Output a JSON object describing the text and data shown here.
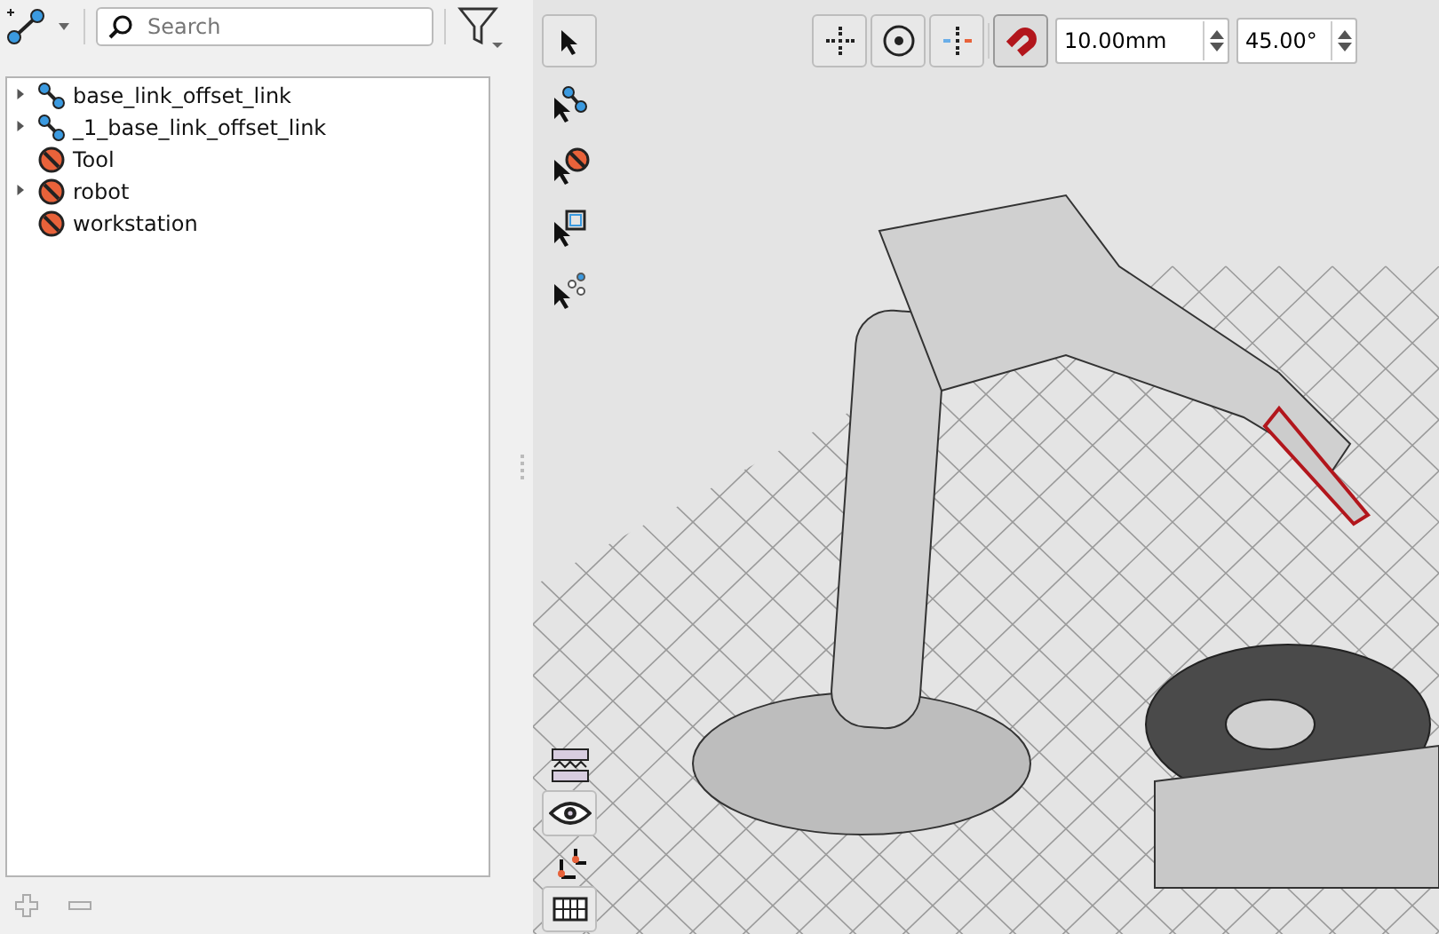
{
  "toolbar": {
    "search": {
      "placeholder": "Search"
    }
  },
  "tree": {
    "items": [
      {
        "label": "base_link_offset_link",
        "kind": "link",
        "expanded": false
      },
      {
        "label": "_1_base_link_offset_link",
        "kind": "link",
        "expanded": false
      },
      {
        "label": "Tool",
        "kind": "body"
      },
      {
        "label": "robot",
        "kind": "body",
        "expanded": false
      },
      {
        "label": "workstation",
        "kind": "body"
      }
    ]
  },
  "viewport": {
    "snap_buttons": [
      {
        "kind": "grid",
        "selected": false
      },
      {
        "kind": "rotate",
        "selected": false
      },
      {
        "kind": "axis",
        "selected": false
      },
      {
        "kind": "magnet",
        "selected": true
      }
    ],
    "step_field": {
      "value": "10.00mm"
    },
    "angle_field": {
      "value": "45.00°"
    },
    "side_tools": [
      {
        "kind": "pointer",
        "selected": true
      },
      {
        "kind": "link",
        "selected": false
      },
      {
        "kind": "body",
        "selected": false
      },
      {
        "kind": "frame",
        "selected": false
      },
      {
        "kind": "graph",
        "selected": false
      }
    ],
    "bottom_tools": [
      {
        "kind": "layers",
        "selected": false
      },
      {
        "kind": "eye",
        "selected": true
      },
      {
        "kind": "axes",
        "selected": false
      },
      {
        "kind": "table",
        "selected": true
      }
    ]
  }
}
